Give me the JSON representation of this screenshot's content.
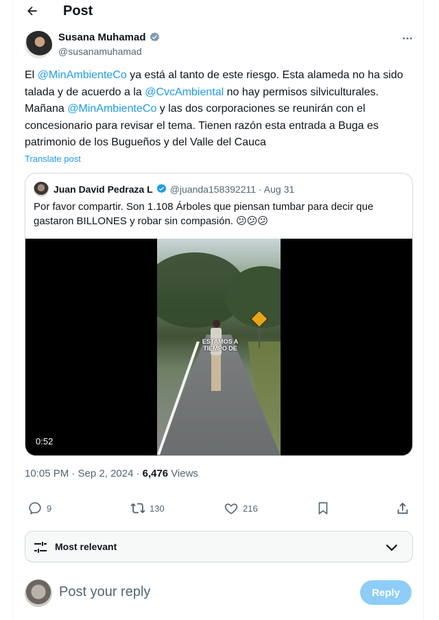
{
  "header": {
    "title": "Post"
  },
  "post": {
    "author_name": "Susana Muhamad",
    "author_handle": "@susanamuhamad",
    "text_parts": {
      "p1": "El ",
      "m1": "@MinAmbienteCo",
      "p2": " ya está al tanto de este riesgo. Esta alameda no ha sido talada y de acuerdo a la ",
      "m2": "@CvcAmbiental",
      "p3": " no hay permisos silviculturales. Mañana ",
      "m3": "@MinAmbienteCo",
      "p4": " y las dos corporaciones se reunirán con el concesionario para revisar el tema. Tienen razón esta entrada a Buga es patrimonio de los Bugueños y del Valle del Cauca"
    },
    "translate_label": "Translate post",
    "timestamp": "10:05 PM · Sep 2, 2024 ·",
    "views_count": "6,476",
    "views_label": "Views"
  },
  "quote": {
    "author_name": "Juan David Pedraza L",
    "author_handle": "@juanda158392211",
    "date": "· Aug 31",
    "text": "Por favor compartir. Son 1.108 Árboles que piensan tumbar para decir que gastaron BILLONES y robar sin compasión. 😕😕😕",
    "video": {
      "overlay_text": "ESTAMOS A TIEMPO DE",
      "duration": "0:52"
    }
  },
  "actions": {
    "replies": "9",
    "reposts": "130",
    "likes": "216"
  },
  "sort": {
    "label": "Most relevant"
  },
  "reply": {
    "placeholder": "Post your reply",
    "button_label": "Reply"
  },
  "colors": {
    "accent": "#1d9bf0",
    "reply_button": "#8ecdf8",
    "muted_text": "#536471"
  }
}
